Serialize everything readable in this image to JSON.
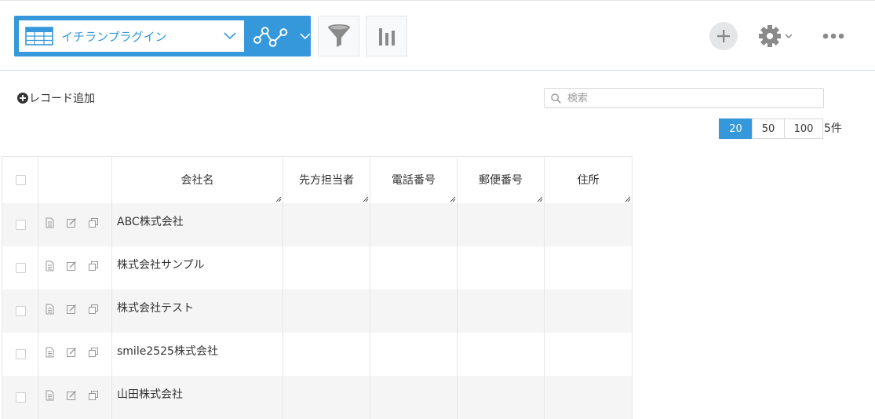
{
  "toolbar": {
    "view_name": "イチランプラグイン"
  },
  "actions": {
    "add_record": "レコード追加"
  },
  "search": {
    "placeholder": "検索",
    "value": ""
  },
  "pager": {
    "options": [
      "20",
      "50",
      "100"
    ],
    "selected": "20",
    "count": "5件"
  },
  "table": {
    "columns": [
      "会社名",
      "先方担当者",
      "電話番号",
      "郵便番号",
      "住所"
    ],
    "rows": [
      {
        "company": "ABC株式会社",
        "contact": "",
        "phone": "",
        "zip": "",
        "address": ""
      },
      {
        "company": "株式会社サンプル",
        "contact": "",
        "phone": "",
        "zip": "",
        "address": ""
      },
      {
        "company": "株式会社テスト",
        "contact": "",
        "phone": "",
        "zip": "",
        "address": ""
      },
      {
        "company": "smile2525株式会社",
        "contact": "",
        "phone": "",
        "zip": "",
        "address": ""
      },
      {
        "company": "山田株式会社",
        "contact": "",
        "phone": "",
        "zip": "",
        "address": ""
      }
    ]
  },
  "icons": {
    "view_type": "table-icon",
    "graph": "graph-icon",
    "filter": "filter-icon",
    "chart": "bar-chart-icon",
    "add": "plus-icon",
    "settings": "gear-icon",
    "more": "more-icon",
    "row_detail": "document-icon",
    "row_edit": "edit-icon",
    "row_copy": "copy-icon"
  },
  "colors": {
    "accent": "#3498db",
    "row_stripe": "#f5f5f5",
    "icon_gray": "#999999"
  }
}
